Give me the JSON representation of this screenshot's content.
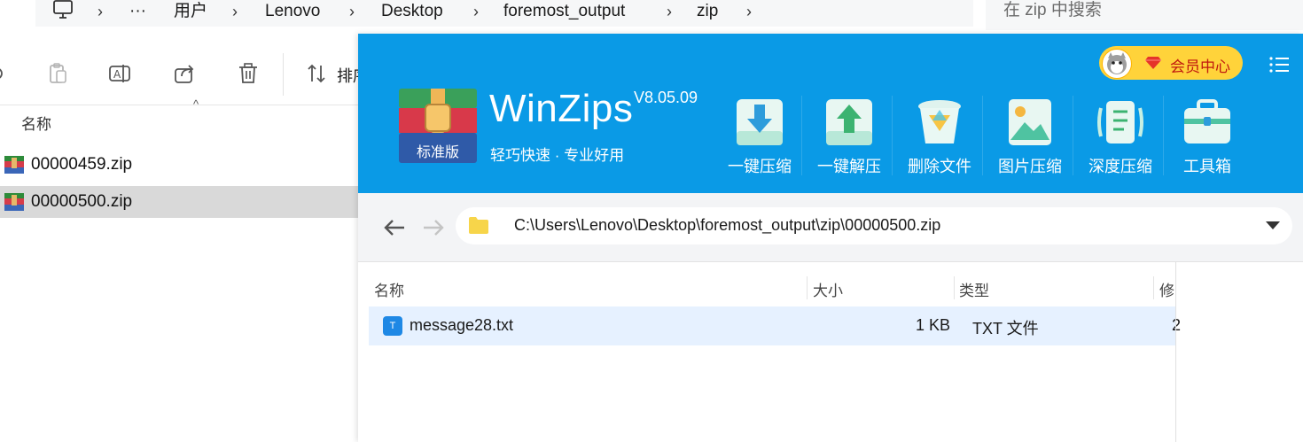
{
  "explorer": {
    "breadcrumb": [
      "用户",
      "Lenovo",
      "Desktop",
      "foremost_output",
      "zip"
    ],
    "more_label": "···",
    "search_placeholder": "在 zip 中搜索",
    "sort_label": "排序",
    "column_name": "名称",
    "files": [
      {
        "name": "00000459.zip",
        "selected": false
      },
      {
        "name": "00000500.zip",
        "selected": true
      }
    ]
  },
  "winzips": {
    "app_name": "WinZips",
    "version": "V8.05.09",
    "slogan": "轻巧快速 · 专业好用",
    "edition_badge": "标准版",
    "vip_label": "会员中心",
    "tools": [
      {
        "label": "一键压缩",
        "icon": "compress-icon"
      },
      {
        "label": "一键解压",
        "icon": "extract-icon"
      },
      {
        "label": "删除文件",
        "icon": "delete-file-icon"
      },
      {
        "label": "图片压缩",
        "icon": "image-compress-icon"
      },
      {
        "label": "深度压缩",
        "icon": "deep-compress-icon"
      },
      {
        "label": "工具箱",
        "icon": "toolbox-icon"
      }
    ],
    "path": "C:\\Users\\Lenovo\\Desktop\\foremost_output\\zip\\00000500.zip",
    "columns": [
      "名称",
      "大小",
      "类型",
      "修"
    ],
    "rows": [
      {
        "icon_letter": "T",
        "name": "message28.txt",
        "size": "1 KB",
        "type": "TXT 文件",
        "modified": "2"
      }
    ],
    "colors": {
      "header_bg": "#0a9ae6",
      "vip_bg": "#ffd33a",
      "row_selected": "#e6f1ff"
    }
  }
}
